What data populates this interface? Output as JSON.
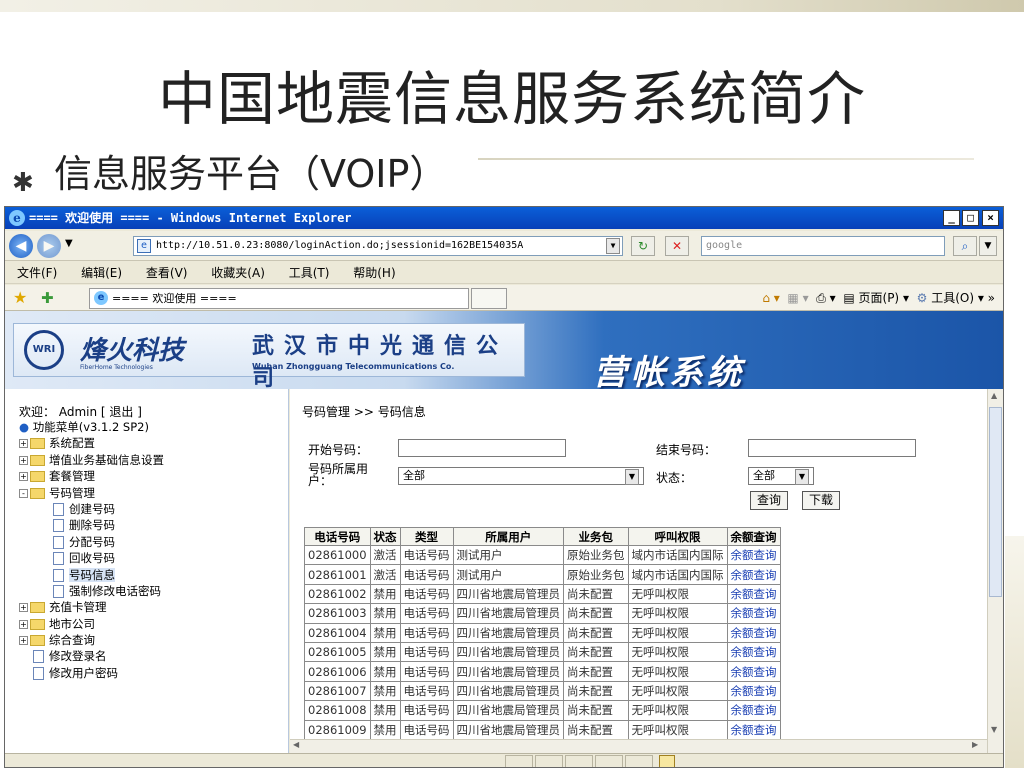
{
  "slide": {
    "title": "中国地震信息服务系统简介",
    "bullet": "✱",
    "subtitle": "信息服务平台（VOIP）"
  },
  "browser": {
    "title": "==== 欢迎使用 ==== - Windows Internet Explorer",
    "controls": {
      "min": "_",
      "max": "□",
      "close": "×"
    },
    "address": "http://10.51.0.23:8080/loginAction.do;jsessionid=162BE154035A",
    "search_placeholder": "google",
    "menu": [
      "文件(F)",
      "编辑(E)",
      "查看(V)",
      "收藏夹(A)",
      "工具(T)",
      "帮助(H)"
    ],
    "tab_title": "==== 欢迎使用 ====",
    "tools": {
      "page": "页面(P)",
      "tools": "工具(O)",
      "more": "»"
    }
  },
  "banner": {
    "logo": "WRI",
    "brand": "烽火科技",
    "brand_sub": "FiberHome Technologies",
    "company_cn": "武汉市中光通信公司",
    "company_en": "Wuhan Zhongguang Telecommunications Co.",
    "system": "营帐系统"
  },
  "sidebar": {
    "welcome": "欢迎：",
    "user": "Admin",
    "logout": "[ 退出 ]",
    "menu_title": "功能菜单(v3.1.2 SP2)",
    "items": [
      {
        "label": "系统配置",
        "type": "folder",
        "exp": "+"
      },
      {
        "label": "增值业务基础信息设置",
        "type": "folder",
        "exp": "+"
      },
      {
        "label": "套餐管理",
        "type": "folder",
        "exp": "+"
      },
      {
        "label": "号码管理",
        "type": "folder",
        "exp": "-"
      },
      {
        "label": "创建号码",
        "type": "doc"
      },
      {
        "label": "删除号码",
        "type": "doc"
      },
      {
        "label": "分配号码",
        "type": "doc"
      },
      {
        "label": "回收号码",
        "type": "doc"
      },
      {
        "label": "号码信息",
        "type": "doc",
        "selected": true
      },
      {
        "label": "强制修改电话密码",
        "type": "doc"
      },
      {
        "label": "充值卡管理",
        "type": "folder",
        "exp": "+"
      },
      {
        "label": "地市公司",
        "type": "folder",
        "exp": "+"
      },
      {
        "label": "综合查询",
        "type": "folder",
        "exp": "+"
      },
      {
        "label": "修改登录名",
        "type": "doc",
        "level": 0
      },
      {
        "label": "修改用户密码",
        "type": "doc",
        "level": 0
      }
    ]
  },
  "main": {
    "breadcrumb": "号码管理 >> 号码信息",
    "start_label": "开始号码：",
    "end_label": "结束号码：",
    "owner_label_1": "号码所属用",
    "owner_label_2": "户：",
    "owner_value": "全部",
    "status_label": "状态：",
    "status_value": "全部",
    "query_btn": "查询",
    "download_btn": "下载",
    "columns": [
      "电话号码",
      "状态",
      "类型",
      "所属用户",
      "业务包",
      "呼叫权限",
      "余额查询"
    ],
    "rows": [
      [
        "02861000",
        "激活",
        "电话号码",
        "测试用户",
        "原始业务包",
        "域内市话国内国际",
        "余额查询"
      ],
      [
        "02861001",
        "激活",
        "电话号码",
        "测试用户",
        "原始业务包",
        "域内市话国内国际",
        "余额查询"
      ],
      [
        "02861002",
        "禁用",
        "电话号码",
        "四川省地震局管理员",
        "尚未配置",
        "无呼叫权限",
        "余额查询"
      ],
      [
        "02861003",
        "禁用",
        "电话号码",
        "四川省地震局管理员",
        "尚未配置",
        "无呼叫权限",
        "余额查询"
      ],
      [
        "02861004",
        "禁用",
        "电话号码",
        "四川省地震局管理员",
        "尚未配置",
        "无呼叫权限",
        "余额查询"
      ],
      [
        "02861005",
        "禁用",
        "电话号码",
        "四川省地震局管理员",
        "尚未配置",
        "无呼叫权限",
        "余额查询"
      ],
      [
        "02861006",
        "禁用",
        "电话号码",
        "四川省地震局管理员",
        "尚未配置",
        "无呼叫权限",
        "余额查询"
      ],
      [
        "02861007",
        "禁用",
        "电话号码",
        "四川省地震局管理员",
        "尚未配置",
        "无呼叫权限",
        "余额查询"
      ],
      [
        "02861008",
        "禁用",
        "电话号码",
        "四川省地震局管理员",
        "尚未配置",
        "无呼叫权限",
        "余额查询"
      ],
      [
        "02861009",
        "禁用",
        "电话号码",
        "四川省地震局管理员",
        "尚未配置",
        "无呼叫权限",
        "余额查询"
      ]
    ]
  },
  "colors": {
    "titlebar": "#0a50cc",
    "banner_dark": "#1b55a8",
    "link": "#1a3fb3",
    "folder": "#f5d76a"
  }
}
